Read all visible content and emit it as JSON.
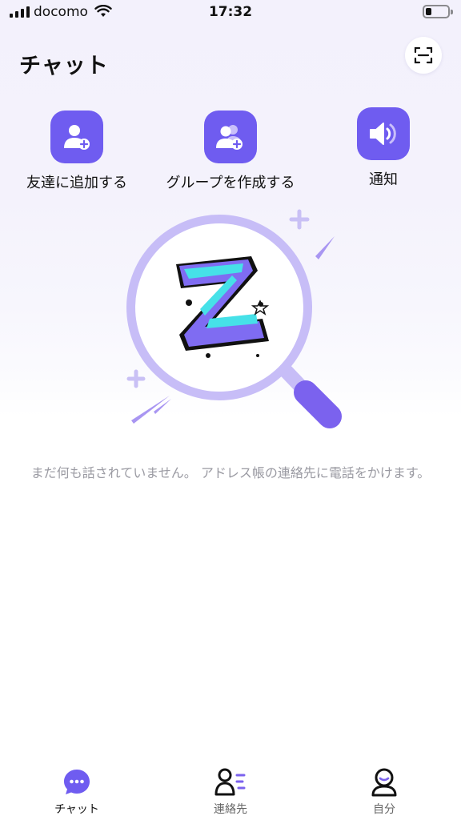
{
  "status": {
    "carrier": "docomo",
    "time": "17:32"
  },
  "header": {
    "title": "チャット",
    "scan_icon": "scan-frame-icon"
  },
  "actions": [
    {
      "label": "友達に追加する",
      "icon": "add-user-icon"
    },
    {
      "label": "グループを作成する",
      "icon": "create-group-icon"
    },
    {
      "label": "通知",
      "icon": "speaker-icon"
    }
  ],
  "empty": {
    "message": "まだ何も話されていません。 アドレス帳の連絡先に電話をかけます。"
  },
  "tabs": [
    {
      "label": "チャット",
      "icon": "chat-bubble-icon",
      "active": true
    },
    {
      "label": "連絡先",
      "icon": "contacts-icon",
      "active": false
    },
    {
      "label": "自分",
      "icon": "profile-icon",
      "active": false
    }
  ],
  "colors": {
    "accent": "#6f5cf0",
    "accent_light": "#d9d3fb",
    "text_muted": "#9a9aa2"
  }
}
